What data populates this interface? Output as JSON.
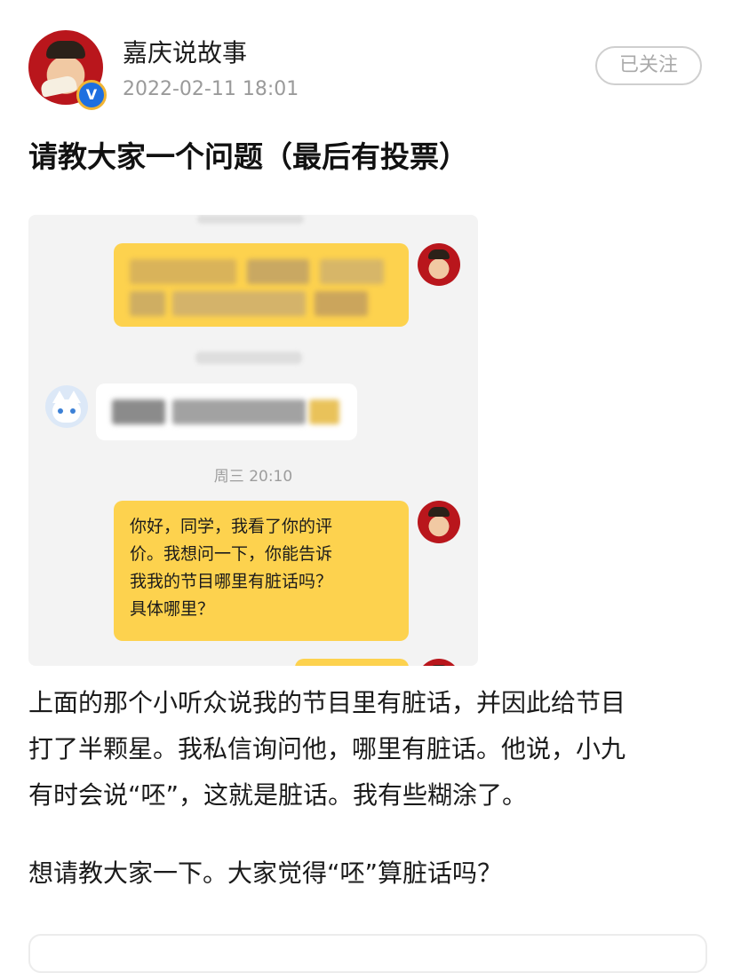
{
  "post": {
    "author_name": "嘉庆说故事",
    "timestamp": "2022-02-11 18:01",
    "follow_label": "已关注",
    "verified_label": "V",
    "title": "请教大家一个问题（最后有投票）"
  },
  "screenshot": {
    "chat_time": "周三 20:10",
    "message_lines": [
      "你好，同学，我看了你的评",
      "价。我想问一下，你能告诉",
      "我我的节目哪里有脏话吗？",
      "具体哪里？"
    ]
  },
  "body": {
    "paragraph_1_lines": [
      "上面的那个小听众说我的节目里有脏话，并因此给节目",
      "打了半颗星。我私信询问他，哪里有脏话。他说，小九",
      "有时会说“呸”，这就是脏话。我有些糊涂了。"
    ],
    "paragraph_2": "想请教大家一下。大家觉得“呸”算脏话吗？"
  },
  "colors": {
    "bubble_yellow": "#fdd24e",
    "chat_bg": "#f3f3f3",
    "badge_blue": "#1e6fe0"
  },
  "icons": {
    "verified": "verified-badge-icon",
    "author_avatar": "author-avatar",
    "cat_avatar": "cat-avatar-icon"
  }
}
